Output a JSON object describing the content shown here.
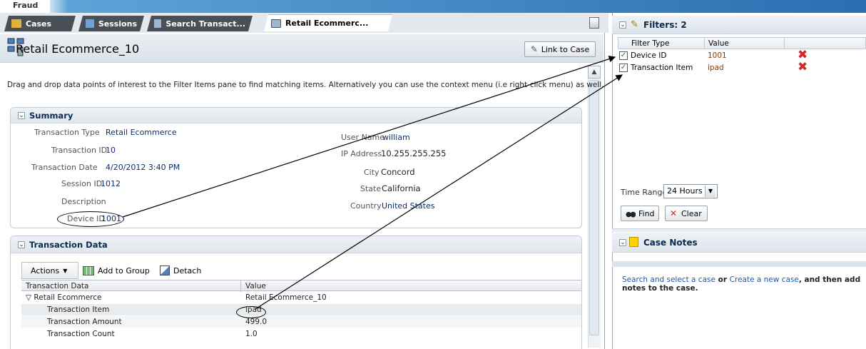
{
  "app": {
    "title": "Fraud"
  },
  "tabs": [
    {
      "label": "Cases"
    },
    {
      "label": "Sessions"
    },
    {
      "label": "Search Transact..."
    },
    {
      "label": "Retail Ecommerc..."
    }
  ],
  "page": {
    "title": "Retail Ecommerce_10",
    "link_button": "Link to Case",
    "instructions": "Drag and drop data points of interest to the Filter Items pane to find matching items. Alternatively you can use the context menu (i.e right-click menu) as well."
  },
  "summary": {
    "title": "Summary",
    "left": [
      {
        "label": "Transaction Type",
        "value": "Retail Ecommerce"
      },
      {
        "label": "Transaction ID",
        "value": "10"
      },
      {
        "label": "Transaction Date",
        "value": "4/20/2012 3:40 PM"
      },
      {
        "label": "Session ID",
        "value": "1012"
      },
      {
        "label": "Description",
        "value": ""
      },
      {
        "label": "Device ID",
        "value": "1001"
      }
    ],
    "right": [
      {
        "label": "User Name",
        "value": "william"
      },
      {
        "label": "IP Address",
        "value": "10.255.255.255"
      },
      {
        "label": "City",
        "value": "Concord"
      },
      {
        "label": "State",
        "value": "California"
      },
      {
        "label": "Country",
        "value": "United States"
      }
    ]
  },
  "transaction_data": {
    "title": "Transaction Data",
    "toolbar": {
      "actions": "Actions",
      "add_group": "Add to Group",
      "detach": "Detach"
    },
    "columns": [
      "Transaction Data",
      "Value"
    ],
    "rows": [
      {
        "name": "Retail Ecommerce",
        "value": "Retail Ecommerce_10",
        "expander": "▽"
      },
      {
        "name": "Transaction Item",
        "value": "ipad"
      },
      {
        "name": "Transaction Amount",
        "value": "499.0"
      },
      {
        "name": "Transaction Count",
        "value": "1.0"
      }
    ]
  },
  "filters": {
    "title": "Filters: 2",
    "columns": [
      "Filter Type",
      "Value"
    ],
    "rows": [
      {
        "type": "Device ID",
        "value": "1001",
        "checked": true
      },
      {
        "type": "Transaction Item",
        "value": "ipad",
        "checked": true
      }
    ],
    "time_range_label": "Time Range",
    "time_range_value": "24 Hours",
    "find": "Find",
    "clear": "Clear"
  },
  "case_notes": {
    "title": "Case Notes",
    "text_link1": "Search and select a case",
    "text_or": " or ",
    "text_link2": "Create a new case",
    "text_rest": ", and then add notes to the case."
  },
  "colors": {
    "accent": "#2a6fb0",
    "link": "#1d58a6",
    "delete": "#d3282a",
    "check": "#1d7c1d",
    "note": "#ffd400"
  },
  "icons": {
    "cases": "cases-icon",
    "sessions": "sessions-icon",
    "search": "search-icon",
    "retail": "retail-icon",
    "link": "paperclip-icon",
    "filter": "filter-icon",
    "notes": "note-icon",
    "find": "binoculars-icon",
    "clear": "clear-icon",
    "delete": "delete-x-icon"
  }
}
